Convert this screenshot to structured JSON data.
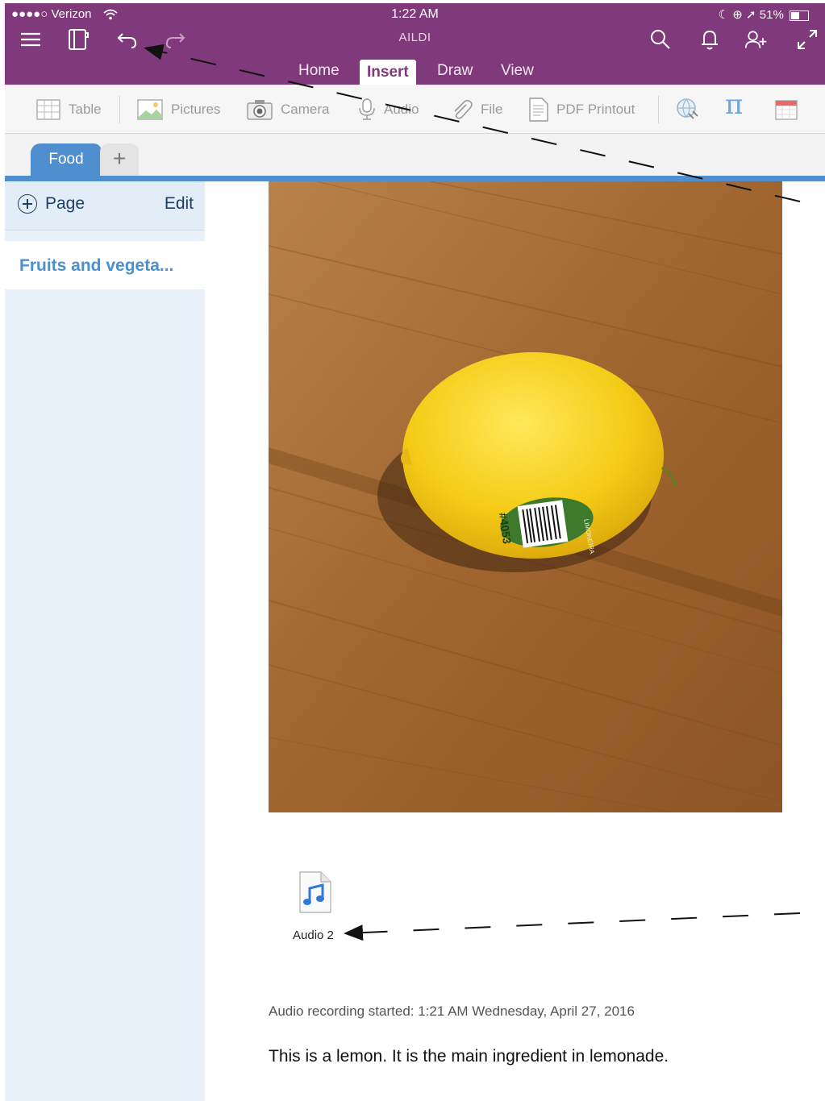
{
  "status_bar": {
    "carrier": "●●●●○ Verizon",
    "time": "1:22 AM",
    "battery": "51%"
  },
  "app": {
    "notebook_title": "AILDI"
  },
  "menu_tabs": [
    {
      "label": "Home",
      "active": false
    },
    {
      "label": "Insert",
      "active": true
    },
    {
      "label": "Draw",
      "active": false
    },
    {
      "label": "View",
      "active": false
    }
  ],
  "ribbon": {
    "table": "Table",
    "pictures": "Pictures",
    "camera": "Camera",
    "audio": "Audio",
    "file": "File",
    "pdf_printout": "PDF Printout"
  },
  "section": {
    "active_tab": "Food",
    "add_symbol": "+"
  },
  "sidebar": {
    "add_page": "Page",
    "edit": "Edit",
    "pages": [
      "Fruits and vegeta..."
    ]
  },
  "content": {
    "audio_attachment": "Audio 2",
    "recording_info": "Audio recording started: 1:21 AM Wednesday, April 27, 2016",
    "body_text": "This is a lemon. It is the main ingredient in lemonade.",
    "sticker_code": "#4053",
    "sticker_brand": "LIMONEIRA"
  },
  "colors": {
    "brand_purple": "#80397b",
    "section_blue": "#4f8fcf",
    "page_link": "#4a90d0"
  }
}
